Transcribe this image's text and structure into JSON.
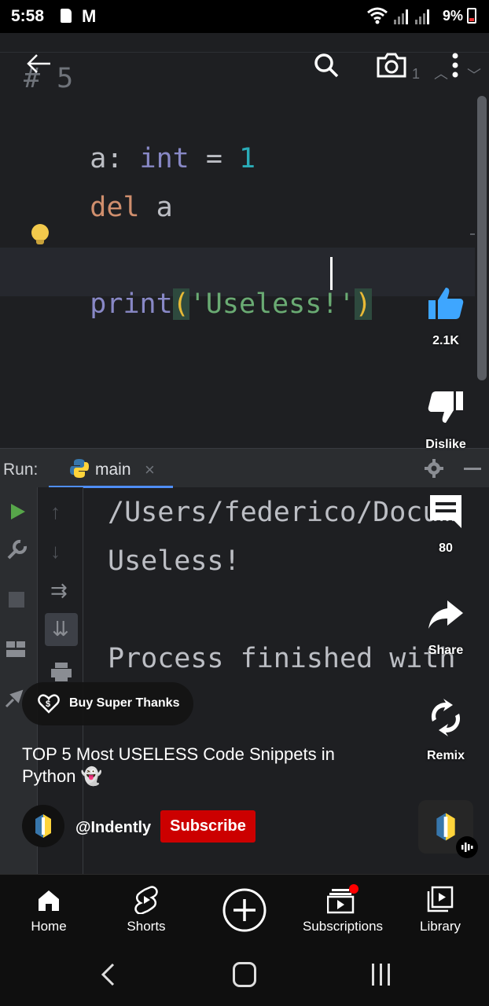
{
  "status_bar": {
    "time": "5:58",
    "battery": "9%",
    "battery_color": "#e33333"
  },
  "editor": {
    "comment_line": "# 5",
    "line1": {
      "name": "a",
      "colon": ":",
      "type": "int",
      "eq": "=",
      "value": "1"
    },
    "line2": {
      "keyword": "del",
      "name": "a"
    },
    "line3": {
      "func": "print",
      "open": "(",
      "string": "'Useless!'",
      "close": ")"
    },
    "match_counter": "1",
    "colors": {
      "background": "#1e1f22",
      "keyword": "#cf8e6d",
      "builtin": "#8888c6",
      "number": "#2aacb8",
      "string": "#6aab73",
      "paren": "#e8ba36"
    }
  },
  "run_panel": {
    "label": "Run:",
    "tab": "main",
    "output_lines": [
      "/Users/federico/Docum",
      "Useless!",
      "",
      "Process finished with"
    ]
  },
  "shorts": {
    "like_count": "2.1K",
    "dislike_label": "Dislike",
    "comment_count": "80",
    "share_label": "Share",
    "remix_label": "Remix",
    "super_thanks": "Buy Super Thanks",
    "title": "TOP 5 Most USELESS Code Snippets in Python 👻",
    "channel": "@Indently",
    "subscribe_label": "Subscribe",
    "subscribe_color": "#cc0000",
    "like_color": "#3ea6ff"
  },
  "bottom_nav": {
    "items": [
      {
        "label": "Home",
        "icon": "home-icon"
      },
      {
        "label": "Shorts",
        "icon": "shorts-icon"
      },
      {
        "label": "",
        "icon": "create-plus-icon"
      },
      {
        "label": "Subscriptions",
        "icon": "subscriptions-icon"
      },
      {
        "label": "Library",
        "icon": "library-icon"
      }
    ]
  }
}
